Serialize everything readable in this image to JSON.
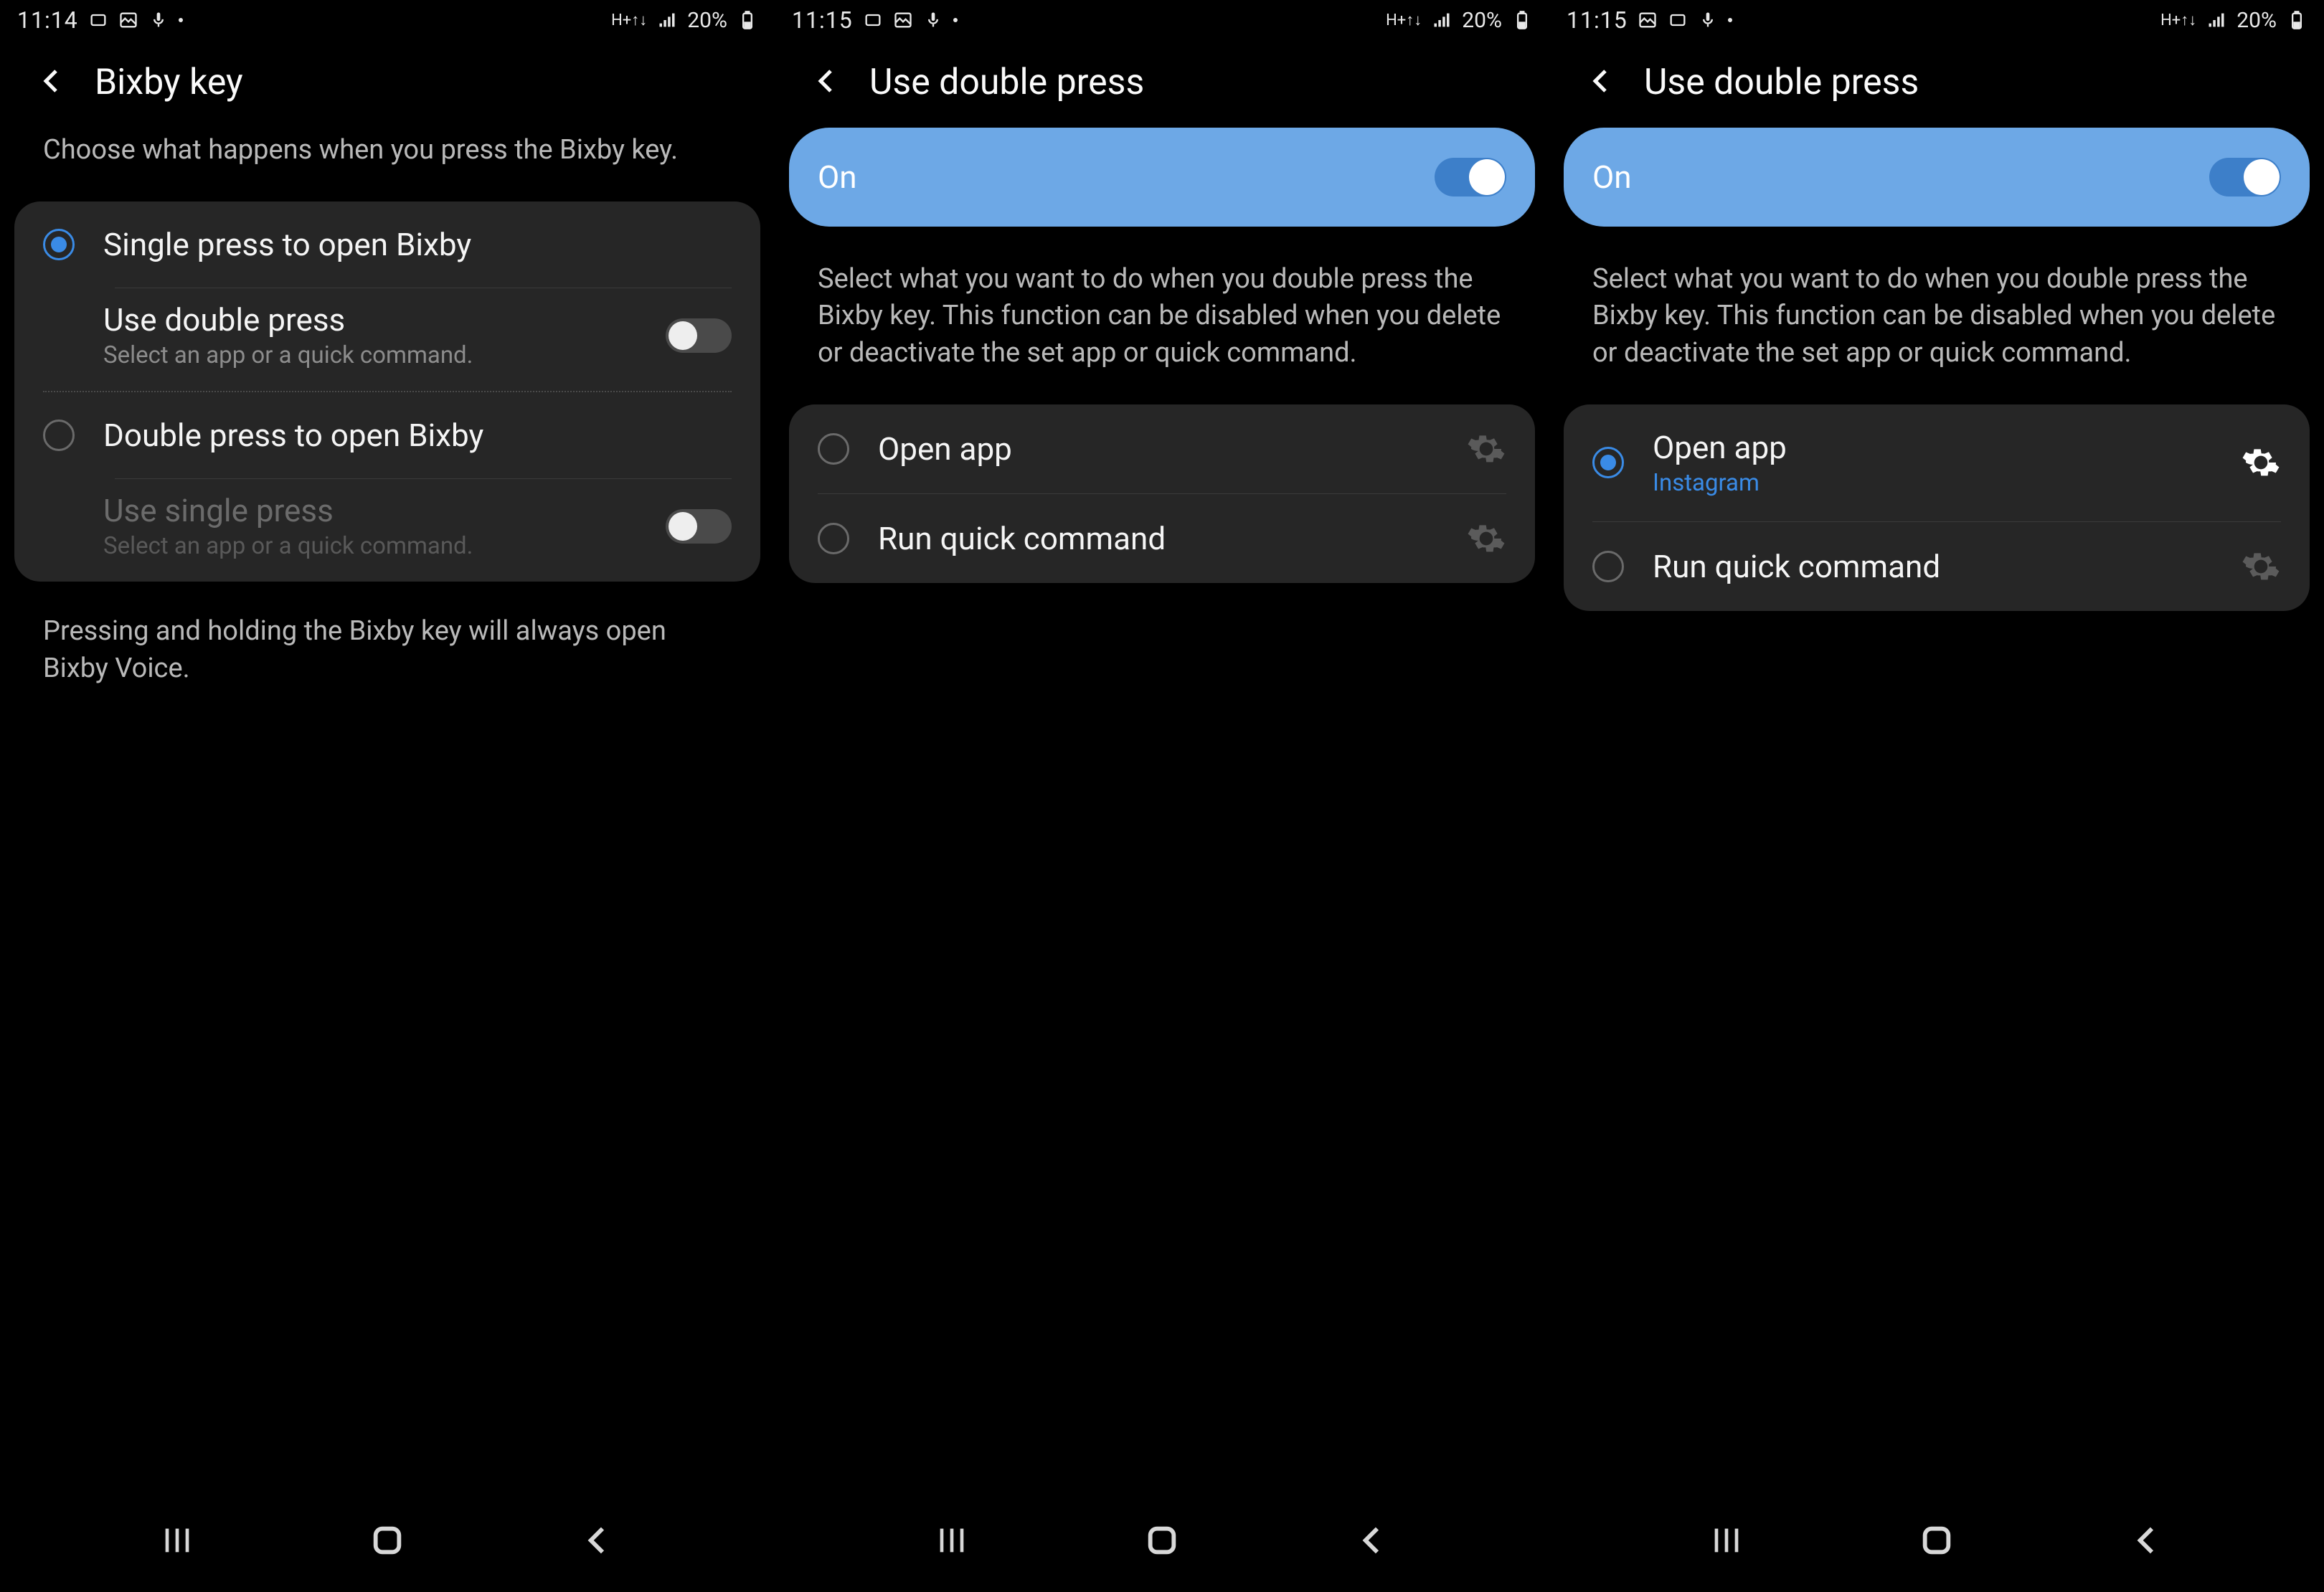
{
  "screens": [
    {
      "status": {
        "time": "11:14",
        "battery_pct": "20%"
      },
      "title": "Bixby key",
      "description": "Choose what happens when you press the Bixby key.",
      "card": {
        "opt1": {
          "label": "Single press to open Bixby",
          "selected": true
        },
        "sub1": {
          "label": "Use double press",
          "sublabel": "Select an app or a quick command.",
          "toggle_on": false
        },
        "opt2": {
          "label": "Double press to open Bixby",
          "selected": false
        },
        "sub2": {
          "label": "Use single press",
          "sublabel": "Select an app or a quick command.",
          "toggle_on": false,
          "dim": true
        }
      },
      "footnote": "Pressing and holding the Bixby key will always open Bixby Voice."
    },
    {
      "status": {
        "time": "11:15",
        "battery_pct": "20%"
      },
      "title": "Use double press",
      "toggle_label": "On",
      "description": "Select what you want to do when you double press the Bixby key. This function can be disabled when you delete or deactivate the set app or quick command.",
      "options": [
        {
          "label": "Open app",
          "selected": false
        },
        {
          "label": "Run quick command",
          "selected": false
        }
      ]
    },
    {
      "status": {
        "time": "11:15",
        "battery_pct": "20%"
      },
      "title": "Use double press",
      "toggle_label": "On",
      "description": "Select what you want to do when you double press the Bixby key. This function can be disabled when you delete or deactivate the set app or quick command.",
      "options": [
        {
          "label": "Open app",
          "sublabel": "Instagram",
          "selected": true
        },
        {
          "label": "Run quick command",
          "selected": false
        }
      ]
    }
  ]
}
